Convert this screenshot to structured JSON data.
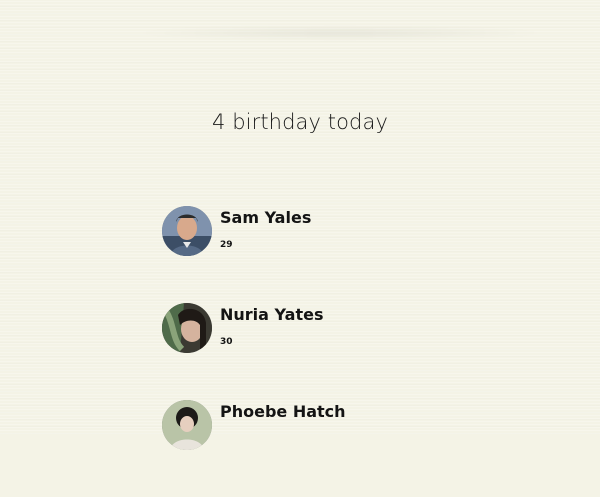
{
  "header": {
    "title": "4 birthday today"
  },
  "people": [
    {
      "name": "Sam Yales",
      "age": "29",
      "avatar_icon": "avatar-man-icon"
    },
    {
      "name": "Nuria Yates",
      "age": "30",
      "avatar_icon": "avatar-woman-icon"
    },
    {
      "name": "Phoebe Hatch",
      "age": "",
      "avatar_icon": "avatar-woman-icon"
    }
  ],
  "colors": {
    "background": "#f4f3e6",
    "text": "#141414"
  }
}
